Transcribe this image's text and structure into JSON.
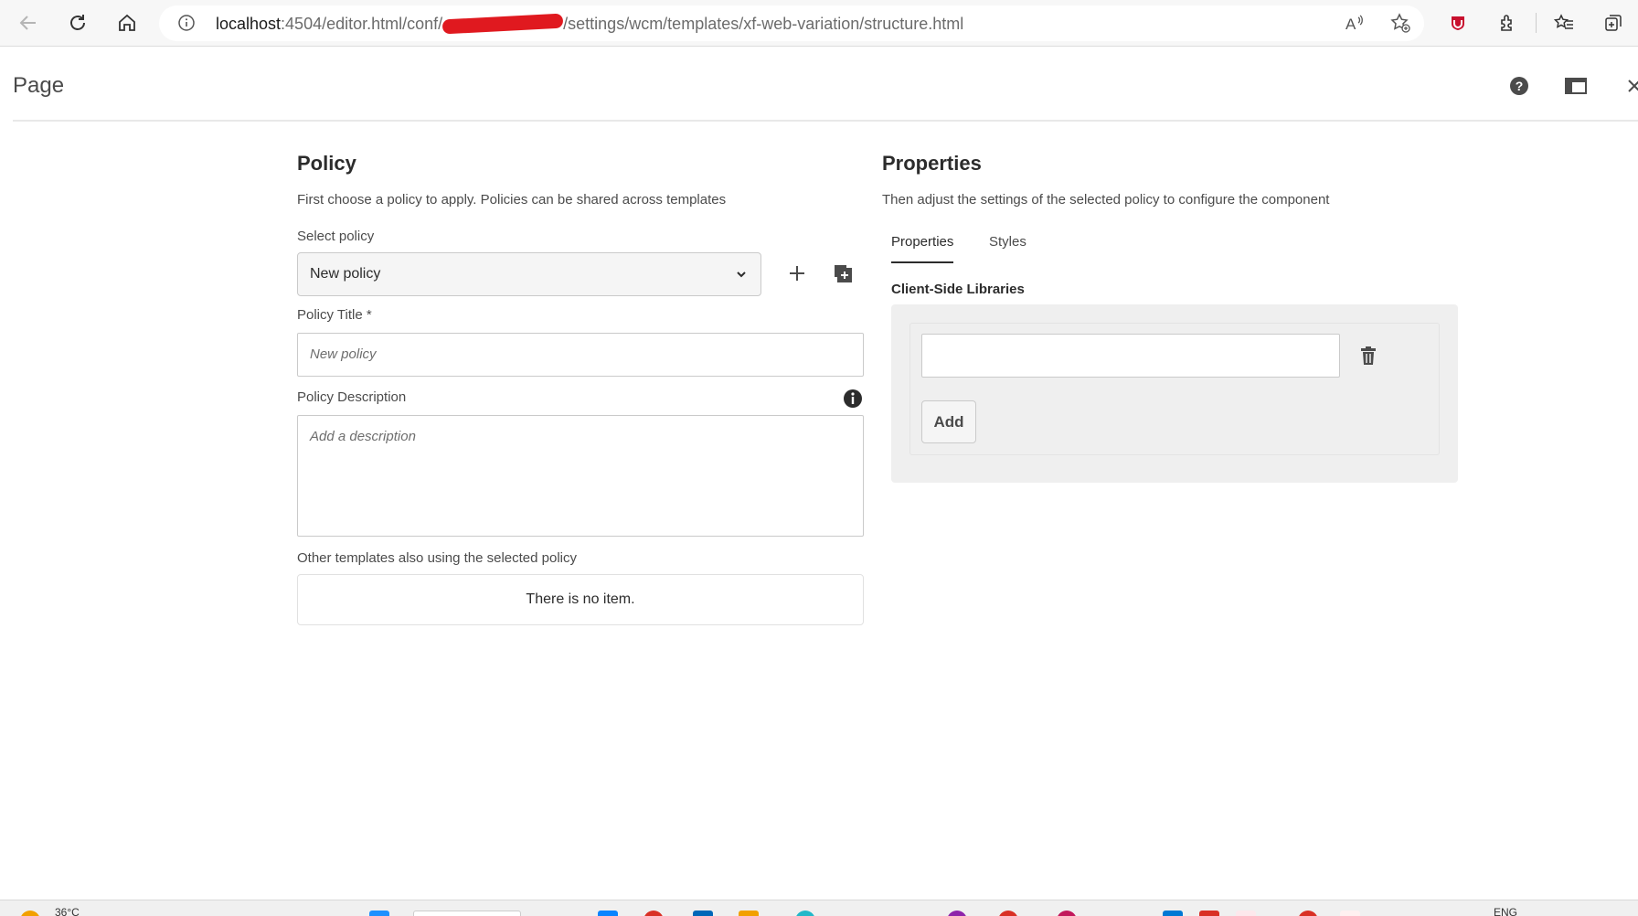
{
  "browser": {
    "url_host": "localhost",
    "url_path_before": ":4504/editor.html/conf/",
    "url_path_after": "/settings/wcm/templates/xf-web-variation/structure.html"
  },
  "header": {
    "title": "Page"
  },
  "policy": {
    "title": "Policy",
    "description": "First choose a policy to apply. Policies can be shared across templates",
    "select_label": "Select policy",
    "selected_policy": "New policy",
    "title_label": "Policy Title *",
    "title_placeholder": "New policy",
    "description_label": "Policy Description",
    "description_placeholder": "Add a description",
    "other_templates_label": "Other templates also using the selected policy",
    "empty_text": "There is no item."
  },
  "properties": {
    "title": "Properties",
    "description": "Then adjust the settings of the selected policy to configure the component",
    "tabs": [
      {
        "label": "Properties",
        "active": true
      },
      {
        "label": "Styles",
        "active": false
      }
    ],
    "client_libs_label": "Client-Side Libraries",
    "add_label": "Add"
  },
  "taskbar": {
    "weather": "36°C",
    "lang": "ENG"
  },
  "colors": {
    "accent_dark": "#2c2c2c",
    "panel_bg": "#efefef",
    "redaction": "#e0191f"
  }
}
